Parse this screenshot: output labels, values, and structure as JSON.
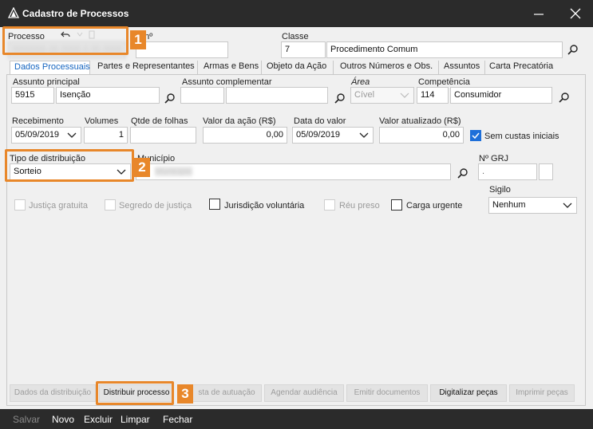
{
  "window": {
    "title": "Cadastro de Processos",
    "minimize_glyph": "—",
    "close_glyph": "✕"
  },
  "processo": {
    "label": "Processo",
    "value": "0000000-00.0000.0.00.0000"
  },
  "process_number": {
    "label_fragment": "o nº",
    "value": ""
  },
  "classe": {
    "label": "Classe",
    "code": "7",
    "name": "Procedimento Comum"
  },
  "tabs": [
    {
      "label": "Dados Processuais"
    },
    {
      "label": "Partes e Representantes"
    },
    {
      "label": "Armas e Bens"
    },
    {
      "label": "Objeto da Ação"
    },
    {
      "label": "Outros Números e Obs."
    },
    {
      "label": "Assuntos"
    },
    {
      "label": "Carta Precatória"
    }
  ],
  "assunto_principal": {
    "label": "Assunto principal",
    "code": "5915",
    "name": "Isenção"
  },
  "assunto_complementar": {
    "label": "Assunto complementar",
    "code": "",
    "name": ""
  },
  "area": {
    "label": "Área",
    "value": "Cível"
  },
  "competencia": {
    "label": "Competência",
    "code": "114",
    "name": "Consumidor"
  },
  "recebimento": {
    "label": "Recebimento",
    "value": "05/09/2019"
  },
  "volumes": {
    "label": "Volumes",
    "value": "1"
  },
  "qtd_folhas": {
    "label": "Qtde de folhas",
    "value": ""
  },
  "valor_acao": {
    "label": "Valor da ação (R$)",
    "value": "0,00"
  },
  "data_valor": {
    "label": "Data do valor",
    "value": "05/09/2019"
  },
  "valor_atualizado": {
    "label": "Valor atualizado (R$)",
    "value": "0,00"
  },
  "sem_custas": {
    "label": "Sem custas iniciais",
    "checked": true
  },
  "tipo_distribuicao": {
    "label": "Tipo de distribuição",
    "value": "Sorteio"
  },
  "municipio": {
    "label": "Município",
    "code": "1",
    "name": "Municipio"
  },
  "grj": {
    "label": "Nº GRJ",
    "value": "."
  },
  "sigilo": {
    "label": "Sigilo",
    "value": "Nenhum"
  },
  "checks": [
    {
      "label": "Justiça gratuita",
      "enabled": false
    },
    {
      "label": "Segredo de justiça",
      "enabled": false
    },
    {
      "label": "Jurisdição voluntária",
      "enabled": true
    },
    {
      "label": "Réu preso",
      "enabled": false
    },
    {
      "label": "Carga urgente",
      "enabled": true
    }
  ],
  "bottom_buttons": [
    {
      "label": "Dados da distribuição",
      "enabled": false
    },
    {
      "label": "Distribuir processo",
      "enabled": true
    },
    {
      "label": "sta de autuação",
      "enabled": false
    },
    {
      "label": "Agendar audiência",
      "enabled": false
    },
    {
      "label": "Emitir documentos",
      "enabled": false
    },
    {
      "label": "Digitalizar peças",
      "enabled": true
    },
    {
      "label": "Imprimir peças",
      "enabled": false
    }
  ],
  "footer": [
    {
      "label": "Salvar",
      "enabled": false
    },
    {
      "label": "Novo",
      "enabled": true
    },
    {
      "label": "Excluir",
      "enabled": true
    },
    {
      "label": "Limpar",
      "enabled": true
    },
    {
      "label": "Fechar",
      "enabled": true
    }
  ],
  "callouts": [
    "1",
    "2",
    "3"
  ],
  "colors": {
    "accent": "#e8872a",
    "link": "#1565c0",
    "titlebar": "#2b2b2b"
  },
  "icons": [
    "app-logo-icon",
    "search-icon",
    "chevron-down-icon",
    "undo-icon",
    "checkmark-icon"
  ]
}
